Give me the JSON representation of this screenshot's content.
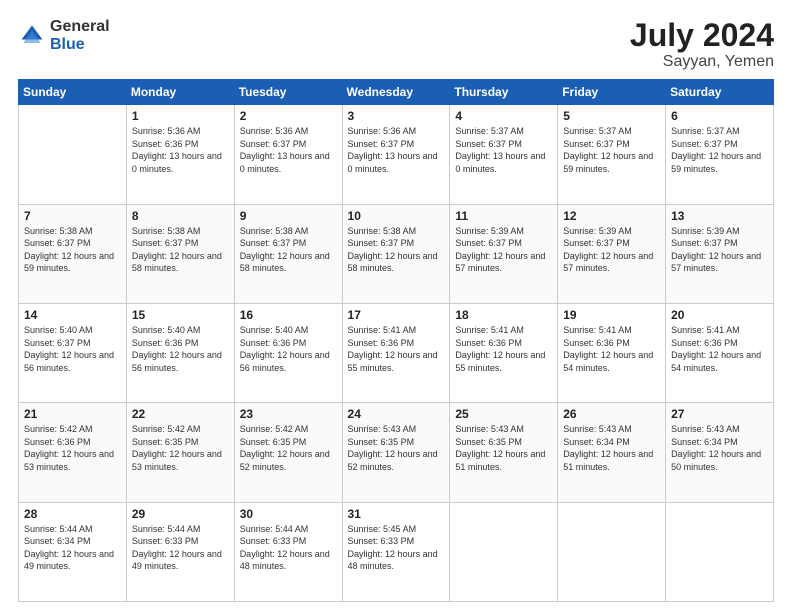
{
  "header": {
    "logo": {
      "general": "General",
      "blue": "Blue"
    },
    "title": "July 2024",
    "location": "Sayyan, Yemen"
  },
  "columns": [
    "Sunday",
    "Monday",
    "Tuesday",
    "Wednesday",
    "Thursday",
    "Friday",
    "Saturday"
  ],
  "weeks": [
    [
      {
        "day": "",
        "sunrise": "",
        "sunset": "",
        "daylight": ""
      },
      {
        "day": "1",
        "sunrise": "Sunrise: 5:36 AM",
        "sunset": "Sunset: 6:36 PM",
        "daylight": "Daylight: 13 hours and 0 minutes."
      },
      {
        "day": "2",
        "sunrise": "Sunrise: 5:36 AM",
        "sunset": "Sunset: 6:37 PM",
        "daylight": "Daylight: 13 hours and 0 minutes."
      },
      {
        "day": "3",
        "sunrise": "Sunrise: 5:36 AM",
        "sunset": "Sunset: 6:37 PM",
        "daylight": "Daylight: 13 hours and 0 minutes."
      },
      {
        "day": "4",
        "sunrise": "Sunrise: 5:37 AM",
        "sunset": "Sunset: 6:37 PM",
        "daylight": "Daylight: 13 hours and 0 minutes."
      },
      {
        "day": "5",
        "sunrise": "Sunrise: 5:37 AM",
        "sunset": "Sunset: 6:37 PM",
        "daylight": "Daylight: 12 hours and 59 minutes."
      },
      {
        "day": "6",
        "sunrise": "Sunrise: 5:37 AM",
        "sunset": "Sunset: 6:37 PM",
        "daylight": "Daylight: 12 hours and 59 minutes."
      }
    ],
    [
      {
        "day": "7",
        "sunrise": "Sunrise: 5:38 AM",
        "sunset": "Sunset: 6:37 PM",
        "daylight": "Daylight: 12 hours and 59 minutes."
      },
      {
        "day": "8",
        "sunrise": "Sunrise: 5:38 AM",
        "sunset": "Sunset: 6:37 PM",
        "daylight": "Daylight: 12 hours and 58 minutes."
      },
      {
        "day": "9",
        "sunrise": "Sunrise: 5:38 AM",
        "sunset": "Sunset: 6:37 PM",
        "daylight": "Daylight: 12 hours and 58 minutes."
      },
      {
        "day": "10",
        "sunrise": "Sunrise: 5:38 AM",
        "sunset": "Sunset: 6:37 PM",
        "daylight": "Daylight: 12 hours and 58 minutes."
      },
      {
        "day": "11",
        "sunrise": "Sunrise: 5:39 AM",
        "sunset": "Sunset: 6:37 PM",
        "daylight": "Daylight: 12 hours and 57 minutes."
      },
      {
        "day": "12",
        "sunrise": "Sunrise: 5:39 AM",
        "sunset": "Sunset: 6:37 PM",
        "daylight": "Daylight: 12 hours and 57 minutes."
      },
      {
        "day": "13",
        "sunrise": "Sunrise: 5:39 AM",
        "sunset": "Sunset: 6:37 PM",
        "daylight": "Daylight: 12 hours and 57 minutes."
      }
    ],
    [
      {
        "day": "14",
        "sunrise": "Sunrise: 5:40 AM",
        "sunset": "Sunset: 6:37 PM",
        "daylight": "Daylight: 12 hours and 56 minutes."
      },
      {
        "day": "15",
        "sunrise": "Sunrise: 5:40 AM",
        "sunset": "Sunset: 6:36 PM",
        "daylight": "Daylight: 12 hours and 56 minutes."
      },
      {
        "day": "16",
        "sunrise": "Sunrise: 5:40 AM",
        "sunset": "Sunset: 6:36 PM",
        "daylight": "Daylight: 12 hours and 56 minutes."
      },
      {
        "day": "17",
        "sunrise": "Sunrise: 5:41 AM",
        "sunset": "Sunset: 6:36 PM",
        "daylight": "Daylight: 12 hours and 55 minutes."
      },
      {
        "day": "18",
        "sunrise": "Sunrise: 5:41 AM",
        "sunset": "Sunset: 6:36 PM",
        "daylight": "Daylight: 12 hours and 55 minutes."
      },
      {
        "day": "19",
        "sunrise": "Sunrise: 5:41 AM",
        "sunset": "Sunset: 6:36 PM",
        "daylight": "Daylight: 12 hours and 54 minutes."
      },
      {
        "day": "20",
        "sunrise": "Sunrise: 5:41 AM",
        "sunset": "Sunset: 6:36 PM",
        "daylight": "Daylight: 12 hours and 54 minutes."
      }
    ],
    [
      {
        "day": "21",
        "sunrise": "Sunrise: 5:42 AM",
        "sunset": "Sunset: 6:36 PM",
        "daylight": "Daylight: 12 hours and 53 minutes."
      },
      {
        "day": "22",
        "sunrise": "Sunrise: 5:42 AM",
        "sunset": "Sunset: 6:35 PM",
        "daylight": "Daylight: 12 hours and 53 minutes."
      },
      {
        "day": "23",
        "sunrise": "Sunrise: 5:42 AM",
        "sunset": "Sunset: 6:35 PM",
        "daylight": "Daylight: 12 hours and 52 minutes."
      },
      {
        "day": "24",
        "sunrise": "Sunrise: 5:43 AM",
        "sunset": "Sunset: 6:35 PM",
        "daylight": "Daylight: 12 hours and 52 minutes."
      },
      {
        "day": "25",
        "sunrise": "Sunrise: 5:43 AM",
        "sunset": "Sunset: 6:35 PM",
        "daylight": "Daylight: 12 hours and 51 minutes."
      },
      {
        "day": "26",
        "sunrise": "Sunrise: 5:43 AM",
        "sunset": "Sunset: 6:34 PM",
        "daylight": "Daylight: 12 hours and 51 minutes."
      },
      {
        "day": "27",
        "sunrise": "Sunrise: 5:43 AM",
        "sunset": "Sunset: 6:34 PM",
        "daylight": "Daylight: 12 hours and 50 minutes."
      }
    ],
    [
      {
        "day": "28",
        "sunrise": "Sunrise: 5:44 AM",
        "sunset": "Sunset: 6:34 PM",
        "daylight": "Daylight: 12 hours and 49 minutes."
      },
      {
        "day": "29",
        "sunrise": "Sunrise: 5:44 AM",
        "sunset": "Sunset: 6:33 PM",
        "daylight": "Daylight: 12 hours and 49 minutes."
      },
      {
        "day": "30",
        "sunrise": "Sunrise: 5:44 AM",
        "sunset": "Sunset: 6:33 PM",
        "daylight": "Daylight: 12 hours and 48 minutes."
      },
      {
        "day": "31",
        "sunrise": "Sunrise: 5:45 AM",
        "sunset": "Sunset: 6:33 PM",
        "daylight": "Daylight: 12 hours and 48 minutes."
      },
      {
        "day": "",
        "sunrise": "",
        "sunset": "",
        "daylight": ""
      },
      {
        "day": "",
        "sunrise": "",
        "sunset": "",
        "daylight": ""
      },
      {
        "day": "",
        "sunrise": "",
        "sunset": "",
        "daylight": ""
      }
    ]
  ]
}
